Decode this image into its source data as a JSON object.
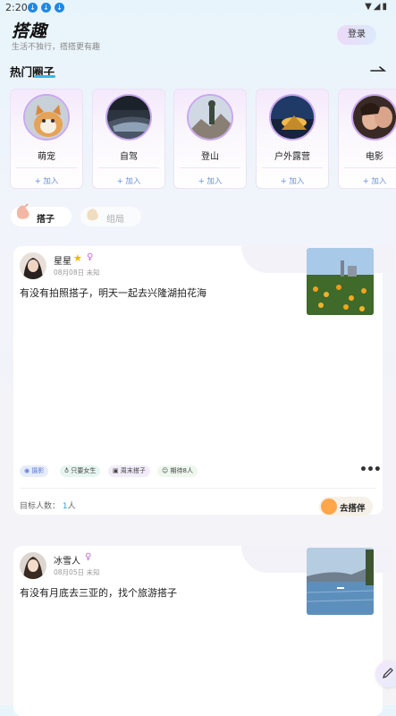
{
  "status_bar": {
    "time": "2:20",
    "download_icons": [
      "download-icon",
      "download-icon",
      "download-icon"
    ],
    "right_icons": [
      "wifi-icon",
      "signal-icon",
      "battery-icon"
    ]
  },
  "header": {
    "title": "搭趣",
    "subtitle": "生活不独行，搭搭更有趣",
    "login_label": "登录"
  },
  "hot_circles": {
    "title": "热门圈子",
    "items": [
      {
        "name": "萌宠",
        "join": "+ 加入"
      },
      {
        "name": "自驾",
        "join": "+ 加入"
      },
      {
        "name": "登山",
        "join": "+ 加入"
      },
      {
        "name": "户外露营",
        "join": "+ 加入"
      },
      {
        "name": "电影",
        "join": "+ 加入"
      }
    ]
  },
  "tabs": [
    {
      "label": "搭子",
      "active": true
    },
    {
      "label": "组局",
      "active": false
    }
  ],
  "posts": [
    {
      "username": "星星",
      "date": "08月08日 未知",
      "text": "有没有拍照搭子，明天一起去兴隆湖拍花海",
      "tags": [
        "摄影",
        "只要女生",
        "周末搭子",
        "期待8人"
      ],
      "target_label": "目标人数：",
      "target_num": "1",
      "target_unit": "人",
      "go_label": "去搭伴"
    },
    {
      "username": "冰雪人",
      "date": "08月05日 未知",
      "text": "有没有月底去三亚的，找个旅游搭子"
    }
  ],
  "colors": {
    "accent": "#3bb6e8",
    "tag_blue": "#5b7fd8",
    "num_blue": "#2a9de8"
  }
}
